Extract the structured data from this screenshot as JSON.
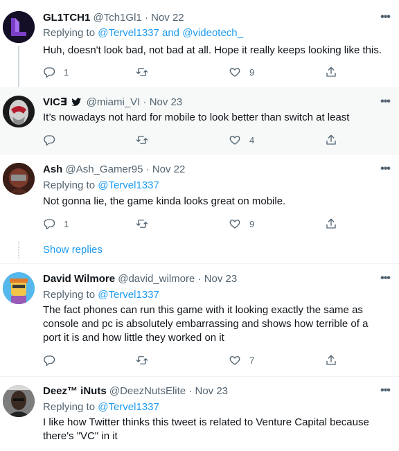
{
  "tweets": [
    {
      "name": "GL1TCH1",
      "handle": "@Tch1Gl1",
      "date": "Nov 22",
      "replying_prefix": "Replying to ",
      "replying_to": [
        "@Tervel1337",
        "@videotech_"
      ],
      "replying_join": " and ",
      "text": "Huh, doesn't look bad, not bad at all. Hope it really keeps looking like this.",
      "replies": "1",
      "retweets": "",
      "likes": "9"
    },
    {
      "name": "VIC∃",
      "handle": "@miami_VI",
      "date": "Nov 23",
      "text": "It’s nowadays not hard for mobile to look better than switch at least",
      "replies": "",
      "retweets": "",
      "likes": "4"
    },
    {
      "name": "Ash",
      "handle": "@Ash_Gamer95",
      "date": "Nov 22",
      "replying_prefix": "Replying to ",
      "replying_to": [
        "@Tervel1337"
      ],
      "text": "Not gonna lie, the game kinda looks great on mobile.",
      "replies": "1",
      "retweets": "",
      "likes": "9"
    },
    {
      "name": "David Wilmore",
      "handle": "@david_wilmore",
      "date": "Nov 23",
      "replying_prefix": "Replying to ",
      "replying_to": [
        "@Tervel1337"
      ],
      "text": "The fact phones can run this game with it looking exactly the same as console and pc is absolutely embarrassing and shows how terrible of a port it is and how little they worked on it",
      "replies": "",
      "retweets": "",
      "likes": "7"
    },
    {
      "name": "Deez™ iNuts",
      "handle": "@DeezNutsElite",
      "date": "Nov 23",
      "replying_prefix": "Replying to ",
      "replying_to": [
        "@Tervel1337"
      ],
      "text": "I like how Twitter thinks this tweet is related to Venture Capital because there's \"VC\" in it"
    }
  ],
  "show_replies": "Show replies",
  "dot": "·",
  "more_glyph": "•••",
  "icons": {
    "reply": "reply-icon",
    "retweet": "retweet-icon",
    "like": "like-icon",
    "share": "share-icon",
    "more": "more-icon",
    "badge": "twitter-bird-icon"
  },
  "colors": {
    "link": "#1d9bf0",
    "secondary_text": "#536471",
    "shaded_background": "#f7f9f9"
  }
}
